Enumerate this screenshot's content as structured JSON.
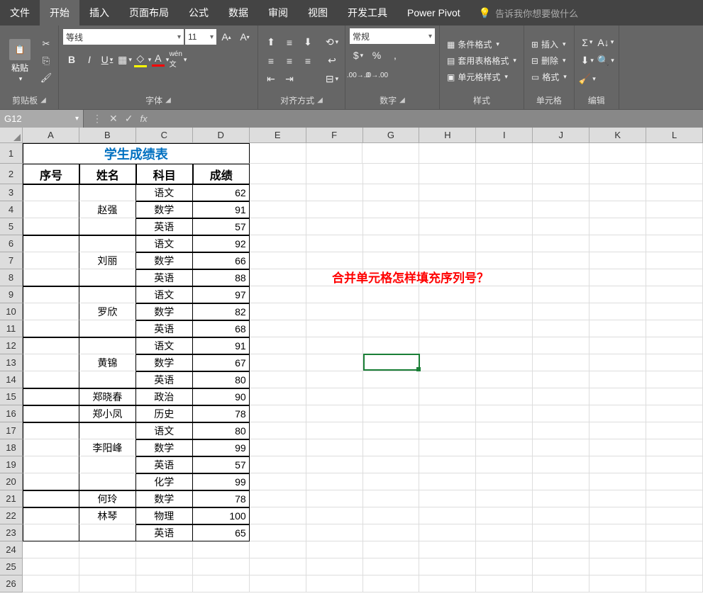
{
  "tabs": [
    "文件",
    "开始",
    "插入",
    "页面布局",
    "公式",
    "数据",
    "审阅",
    "视图",
    "开发工具",
    "Power Pivot"
  ],
  "active_tab": 1,
  "tell_me": "告诉我你想要做什么",
  "groups": {
    "clipboard": {
      "label": "剪贴板",
      "paste": "粘贴"
    },
    "font": {
      "label": "字体",
      "name": "等线",
      "size": "11"
    },
    "align": {
      "label": "对齐方式"
    },
    "number": {
      "label": "数字",
      "format": "常规"
    },
    "styles": {
      "label": "样式",
      "cond": "条件格式",
      "table": "套用表格格式",
      "cell": "单元格样式"
    },
    "cells": {
      "label": "单元格",
      "insert": "插入",
      "delete": "删除",
      "format": "格式"
    },
    "editing": {
      "label": "编辑"
    }
  },
  "name_box": "G12",
  "columns": [
    "A",
    "B",
    "C",
    "D",
    "E",
    "F",
    "G",
    "H",
    "I",
    "J",
    "K",
    "L"
  ],
  "rows": [
    1,
    2,
    3,
    4,
    5,
    6,
    7,
    8,
    9,
    10,
    11,
    12,
    13,
    14,
    15,
    16,
    17,
    18,
    19,
    20,
    21,
    22,
    23,
    24,
    25,
    26
  ],
  "sheet_title": "学生成绩表",
  "headers": {
    "a": "序号",
    "b": "姓名",
    "c": "科目",
    "d": "成绩"
  },
  "data": [
    {
      "name": "赵强",
      "rowspan": 3,
      "rows": [
        [
          "语文",
          62
        ],
        [
          "数学",
          91
        ],
        [
          "英语",
          57
        ]
      ]
    },
    {
      "name": "刘丽",
      "rowspan": 3,
      "rows": [
        [
          "语文",
          92
        ],
        [
          "数学",
          66
        ],
        [
          "英语",
          88
        ]
      ]
    },
    {
      "name": "罗欣",
      "rowspan": 3,
      "rows": [
        [
          "语文",
          97
        ],
        [
          "数学",
          82
        ],
        [
          "英语",
          68
        ]
      ]
    },
    {
      "name": "黄锦",
      "rowspan": 3,
      "rows": [
        [
          "语文",
          91
        ],
        [
          "数学",
          67
        ],
        [
          "英语",
          80
        ]
      ]
    },
    {
      "name": "郑晓春",
      "rowspan": 1,
      "rows": [
        [
          "政治",
          90
        ]
      ]
    },
    {
      "name": "郑小凤",
      "rowspan": 1,
      "rows": [
        [
          "历史",
          78
        ]
      ]
    },
    {
      "name": "李阳峰",
      "rowspan": 4,
      "rows": [
        [
          "语文",
          80
        ],
        [
          "数学",
          99
        ],
        [
          "英语",
          57
        ],
        [
          "化学",
          99
        ]
      ]
    },
    {
      "name": "何玲",
      "rowspan": 1,
      "rows": [
        [
          "数学",
          78
        ]
      ]
    },
    {
      "name": "林琴",
      "rowspan": 2,
      "rows": [
        [
          "物理",
          100
        ],
        [
          "英语",
          65
        ]
      ]
    }
  ],
  "annotation": "合并单元格怎样填充序列号？",
  "chart_data": {
    "type": "table",
    "title": "学生成绩表",
    "columns": [
      "序号",
      "姓名",
      "科目",
      "成绩"
    ],
    "rows": [
      [
        "",
        "赵强",
        "语文",
        62
      ],
      [
        "",
        "赵强",
        "数学",
        91
      ],
      [
        "",
        "赵强",
        "英语",
        57
      ],
      [
        "",
        "刘丽",
        "语文",
        92
      ],
      [
        "",
        "刘丽",
        "数学",
        66
      ],
      [
        "",
        "刘丽",
        "英语",
        88
      ],
      [
        "",
        "罗欣",
        "语文",
        97
      ],
      [
        "",
        "罗欣",
        "数学",
        82
      ],
      [
        "",
        "罗欣",
        "英语",
        68
      ],
      [
        "",
        "黄锦",
        "语文",
        91
      ],
      [
        "",
        "黄锦",
        "数学",
        67
      ],
      [
        "",
        "黄锦",
        "英语",
        80
      ],
      [
        "",
        "郑晓春",
        "政治",
        90
      ],
      [
        "",
        "郑小凤",
        "历史",
        78
      ],
      [
        "",
        "李阳峰",
        "语文",
        80
      ],
      [
        "",
        "李阳峰",
        "数学",
        99
      ],
      [
        "",
        "李阳峰",
        "英语",
        57
      ],
      [
        "",
        "李阳峰",
        "化学",
        99
      ],
      [
        "",
        "何玲",
        "数学",
        78
      ],
      [
        "",
        "林琴",
        "物理",
        100
      ],
      [
        "",
        "林琴",
        "英语",
        65
      ]
    ]
  }
}
